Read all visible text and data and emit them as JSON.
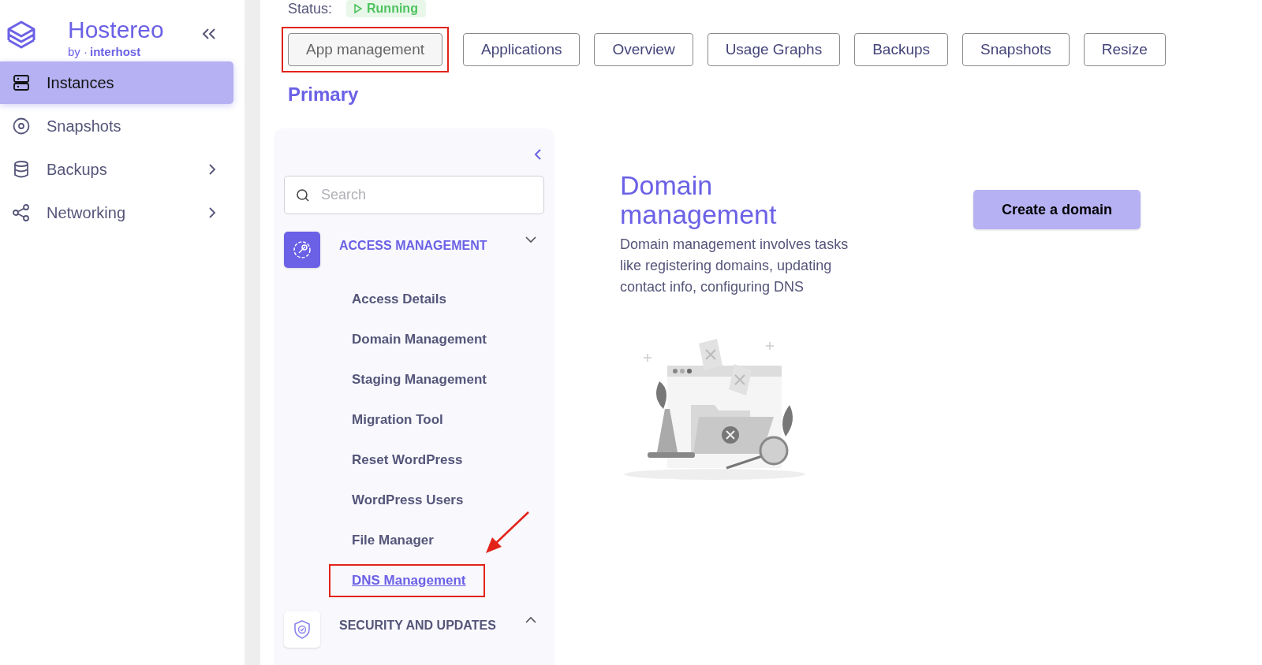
{
  "brand": {
    "name": "Hostereo",
    "byline": "by ·",
    "partner": "interhost"
  },
  "sidebar": {
    "items": [
      {
        "label": "Instances",
        "selected": true,
        "has_submenu": false
      },
      {
        "label": "Snapshots",
        "selected": false,
        "has_submenu": false
      },
      {
        "label": "Backups",
        "selected": false,
        "has_submenu": true
      },
      {
        "label": "Networking",
        "selected": false,
        "has_submenu": true
      }
    ]
  },
  "status": {
    "label": "Status:",
    "value": "Running"
  },
  "tabs": [
    {
      "label": "App management",
      "selected": true
    },
    {
      "label": "Applications",
      "selected": false
    },
    {
      "label": "Overview",
      "selected": false
    },
    {
      "label": "Usage Graphs",
      "selected": false
    },
    {
      "label": "Backups",
      "selected": false
    },
    {
      "label": "Snapshots",
      "selected": false
    },
    {
      "label": "Resize",
      "selected": false
    }
  ],
  "section_title": "Primary",
  "menu": {
    "search": {
      "placeholder": "Search"
    },
    "groups": [
      {
        "title": "ACCESS MANAGEMENT",
        "expanded": true,
        "items": [
          {
            "label": "Access Details",
            "selected": false
          },
          {
            "label": "Domain Management",
            "selected": false
          },
          {
            "label": "Staging Management",
            "selected": false
          },
          {
            "label": "Migration Tool",
            "selected": false
          },
          {
            "label": "Reset WordPress",
            "selected": false
          },
          {
            "label": "WordPress Users",
            "selected": false
          },
          {
            "label": "File Manager",
            "selected": false
          },
          {
            "label": "DNS Management",
            "selected": true
          }
        ]
      },
      {
        "title": "SECURITY AND UPDATES",
        "expanded": false
      }
    ]
  },
  "content": {
    "title": "Domain management",
    "description": "Domain management involves tasks like registering domains, updating contact info, configuring DNS",
    "button": "Create a domain"
  }
}
